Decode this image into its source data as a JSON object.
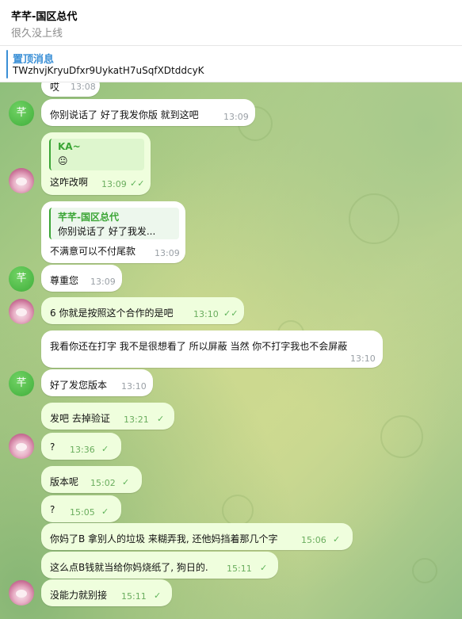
{
  "header": {
    "title": "芊芊-国区总代",
    "status": "很久没上线"
  },
  "pinned": {
    "title": "置顶消息",
    "text": "TWzhvjKryuDfxr9UykatH7uSqfXDtddcyK"
  },
  "colors": {
    "accent": "#3a8fd6",
    "own_bubble": "#effedd",
    "check": "#5fb35a",
    "reply_bar": "#3aa535"
  },
  "avatars": {
    "green_letter": "芊"
  },
  "messages": [
    {
      "text": "哎",
      "time": "13:08",
      "own": false
    },
    {
      "text": "你别说话了 好了我发你版  就到这吧",
      "time": "13:09",
      "own": false
    },
    {
      "reply": {
        "name": "KA~",
        "text": "😐"
      },
      "text": "这咋改啊",
      "time": "13:09",
      "own": true,
      "status": "read"
    },
    {
      "reply": {
        "name": "芊芊-国区总代",
        "text": "你别说话了 好了我发..."
      },
      "text": "不满意可以不付尾款",
      "time": "13:09",
      "own": false
    },
    {
      "text": "尊重您",
      "time": "13:09",
      "own": false
    },
    {
      "text": "6  你就是按照这个合作的是吧",
      "time": "13:10",
      "own": true,
      "status": "read"
    },
    {
      "text": "我看你还在打字 我不是很想看了 所以屏蔽 当然 你不打字我也不会屏蔽",
      "time": "13:10",
      "own": false
    },
    {
      "text": "好了发您版本",
      "time": "13:10",
      "own": false
    },
    {
      "text": "发吧 去掉验证",
      "time": "13:21",
      "own": true,
      "status": "read"
    },
    {
      "text": "?",
      "time": "13:36",
      "own": true,
      "status": "read"
    },
    {
      "text": "版本呢",
      "time": "15:02",
      "own": true,
      "status": "read"
    },
    {
      "text": "?",
      "time": "15:05",
      "own": true,
      "status": "read"
    },
    {
      "text": "你妈了B 拿别人的垃圾 来糊弄我, 还他妈挡着那几个字",
      "time": "15:06",
      "own": true,
      "status": "read"
    },
    {
      "text": "这么点B钱就当给你妈烧纸了, 狗日的.",
      "time": "15:11",
      "own": true,
      "status": "read"
    },
    {
      "text": "没能力就别接",
      "time": "15:11",
      "own": true,
      "status": "read"
    }
  ]
}
